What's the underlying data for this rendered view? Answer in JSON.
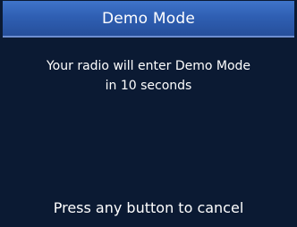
{
  "header": {
    "title": "Demo Mode"
  },
  "message": {
    "line1": "Your radio will enter Demo Mode",
    "line2": "in 10 seconds"
  },
  "footer": {
    "hint": "Press any button to cancel"
  },
  "colors": {
    "background": "#0b1a33",
    "title_bar": "#2f5fb3",
    "text": "#ffffff"
  }
}
